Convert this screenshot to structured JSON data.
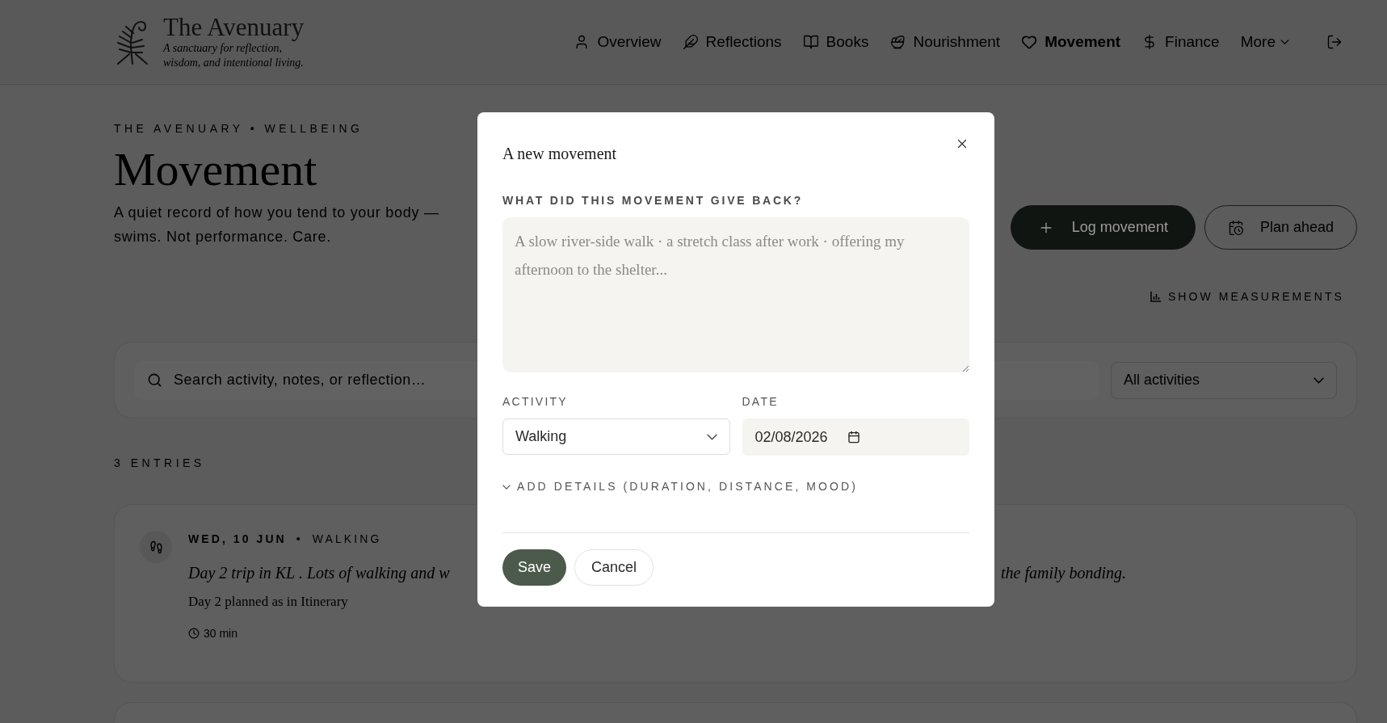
{
  "brand": {
    "name": "The Avenuary",
    "tagline_lines": [
      "A sanctuary for reflection,",
      "wisdom, and intentional living."
    ]
  },
  "nav": [
    {
      "label": "Overview",
      "selected": false
    },
    {
      "label": "Reflections",
      "selected": false
    },
    {
      "label": "Books",
      "selected": false
    },
    {
      "label": "Nourishment",
      "selected": false
    },
    {
      "label": "Movement",
      "selected": true
    },
    {
      "label": "Finance",
      "selected": false
    }
  ],
  "more_menu": {
    "label": "More"
  },
  "page": {
    "breadcrumb": "THE AVENUARY • WELLBEING",
    "title": "Movement",
    "subtitle_lines": [
      "A quiet record of how you tend to your body —",
      "swims. Not performance. Care."
    ]
  },
  "actions": [
    {
      "label": "Log movement",
      "kind": "primary"
    },
    {
      "label": "Plan ahead",
      "kind": "secondary"
    }
  ],
  "measurements_toggle": {
    "label": "SHOW MEASUREMENTS"
  },
  "filter": {
    "search_placeholder": "Search activity, notes, or reflection…",
    "activity_select": "All activities"
  },
  "entries_count": "3 ENTRIES",
  "entries": [
    {
      "date": "WED, 10 JUN",
      "separator": "•",
      "activity": "WALKING",
      "title_start": "Day 2 trip in KL . Lots of walking and w",
      "title_end": "the family bonding.",
      "note": "Day 2 planned as in Itinerary",
      "duration": "30 min"
    }
  ],
  "modal": {
    "title": "A new movement",
    "question_label": "WHAT DID THIS MOVEMENT GIVE BACK?",
    "question_placeholder": "A slow river-side walk · a stretch class after work · offering my afternoon to the shelter...",
    "activity_label": "ACTIVITY",
    "activity_value": "Walking",
    "date_label": "DATE",
    "date_value": "02/08/2026",
    "details_toggle": {
      "label": "ADD DETAILS (DURATION, DISTANCE, MOOD)",
      "expanded": false
    },
    "save": "Save",
    "cancel": "Cancel"
  }
}
